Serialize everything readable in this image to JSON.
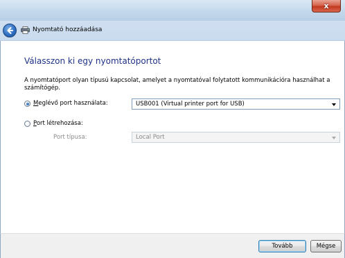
{
  "window": {
    "close_glyph": "x",
    "title": "Nyomtató hozzáadása"
  },
  "page": {
    "heading": "Válasszon ki egy nyomtatóportot",
    "description": "A nyomtatóport olyan típusú kapcsolat, amelyet a nyomtatóval folytatott kommunikációra használhat a számítógép."
  },
  "options": {
    "existing_port": {
      "label_accel": "M",
      "label_rest": "eglévő port használata:",
      "selected": true,
      "value": "USB001 (Virtual printer port for USB)"
    },
    "create_port": {
      "label_accel": "P",
      "label_rest": "ort létrehozása:",
      "selected": false,
      "type_label": "Port típusa:",
      "type_value": "Local Port"
    }
  },
  "footer": {
    "next_label": "Tovább",
    "cancel_label": "Mégse"
  },
  "colors": {
    "heading": "#1e3287",
    "disabled_text": "#8a8a8a",
    "accent": "#2f6fc2"
  },
  "icons": {
    "back": "back-arrow-icon",
    "printer": "printer-icon",
    "close": "close-icon"
  }
}
